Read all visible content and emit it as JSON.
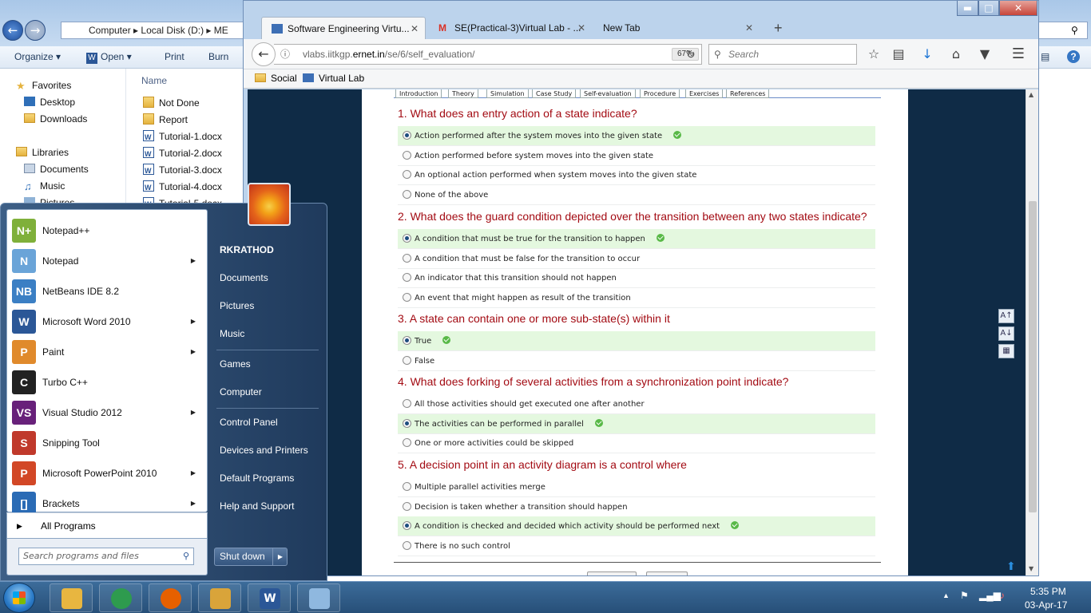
{
  "explorer": {
    "address": [
      "Computer",
      "Local Disk (D:)",
      "ME"
    ],
    "toolbar": {
      "organize": "Organize",
      "open": "Open",
      "print": "Print",
      "burn": "Burn"
    },
    "nav": {
      "favorites": "Favorites",
      "desktop": "Desktop",
      "downloads": "Downloads",
      "libraries": "Libraries",
      "documents": "Documents",
      "music": "Music",
      "pictures": "Pictures"
    },
    "column_name": "Name",
    "files": [
      "Not Done",
      "Report",
      "Tutorial-1.docx",
      "Tutorial-2.docx",
      "Tutorial-3.docx",
      "Tutorial-4.docx",
      "Tutorial-5.docx"
    ]
  },
  "firefox": {
    "tabs": [
      {
        "label": "Software Engineering Virtu..."
      },
      {
        "label": "SE(Practical-3)Virtual Lab - ..."
      },
      {
        "label": "New Tab"
      }
    ],
    "url_prefix": "vlabs.iitkgp.",
    "url_domain": "ernet.in",
    "url_path": "/se/6/self_evaluation/",
    "zoom": "67%",
    "search_placeholder": "Search",
    "bookmarks": [
      "Social",
      "Virtual Lab"
    ]
  },
  "lab": {
    "tabs": [
      "Introduction",
      "Theory",
      "Simulation",
      "Case Study",
      "Self-evaluation",
      "Procedure",
      "Exercises",
      "References"
    ],
    "questions": [
      {
        "text": "1. What does an entry action of a state indicate?",
        "options": [
          {
            "text": "Action performed after the system moves into the given state",
            "selected": true,
            "correct": true
          },
          {
            "text": "Action performed before system moves into the given state",
            "selected": false,
            "correct": false
          },
          {
            "text": "An optional action performed when system moves into the given state",
            "selected": false,
            "correct": false
          },
          {
            "text": "None of the above",
            "selected": false,
            "correct": false
          }
        ]
      },
      {
        "text": "2. What does the guard condition depicted over the transition between any two states indicate?",
        "options": [
          {
            "text": "A condition that must be true for the transition to happen",
            "selected": true,
            "correct": true
          },
          {
            "text": "A condition that must be false for the transition to occur",
            "selected": false,
            "correct": false
          },
          {
            "text": "An indicator that this transition should not happen",
            "selected": false,
            "correct": false
          },
          {
            "text": "An event that might happen as result of the transition",
            "selected": false,
            "correct": false
          }
        ]
      },
      {
        "text": "3. A state can contain one or more sub-state(s) within it",
        "options": [
          {
            "text": "True",
            "selected": true,
            "correct": true
          },
          {
            "text": "False",
            "selected": false,
            "correct": false
          }
        ]
      },
      {
        "text": "4. What does forking of several activities from a synchronization point indicate?",
        "options": [
          {
            "text": "All those activities should get executed one after another",
            "selected": false,
            "correct": false
          },
          {
            "text": "The activities can be performed in parallel",
            "selected": true,
            "correct": true
          },
          {
            "text": "One or more activities could be skipped",
            "selected": false,
            "correct": false
          }
        ]
      },
      {
        "text": "5. A decision point in an activity diagram is a control where",
        "options": [
          {
            "text": "Multiple parallel activities merge",
            "selected": false,
            "correct": false
          },
          {
            "text": "Decision is taken whether a transition should happen",
            "selected": false,
            "correct": false
          },
          {
            "text": "A condition is checked and decided which activity should be performed next",
            "selected": true,
            "correct": true
          },
          {
            "text": "There is no such control",
            "selected": false,
            "correct": false
          }
        ]
      }
    ]
  },
  "startmenu": {
    "programs": [
      {
        "label": "Notepad++",
        "icon": "notepadpp-icon",
        "color": "#7fb03a",
        "glyph": "N+",
        "arrow": false
      },
      {
        "label": "Notepad",
        "icon": "notepad-icon",
        "color": "#6aa4d8",
        "glyph": "N",
        "arrow": true
      },
      {
        "label": "NetBeans IDE 8.2",
        "icon": "netbeans-icon",
        "color": "#3b7fc4",
        "glyph": "NB",
        "arrow": false
      },
      {
        "label": "Microsoft Word 2010",
        "icon": "word-icon",
        "color": "#2b5797",
        "glyph": "W",
        "arrow": true
      },
      {
        "label": "Paint",
        "icon": "paint-icon",
        "color": "#e08a2c",
        "glyph": "P",
        "arrow": true
      },
      {
        "label": "Turbo C++",
        "icon": "turbo-cpp-icon",
        "color": "#222222",
        "glyph": "C",
        "arrow": false
      },
      {
        "label": "Visual Studio 2012",
        "icon": "visual-studio-icon",
        "color": "#68217a",
        "glyph": "VS",
        "arrow": true
      },
      {
        "label": "Snipping Tool",
        "icon": "snipping-tool-icon",
        "color": "#c0392b",
        "glyph": "S",
        "arrow": false
      },
      {
        "label": "Microsoft PowerPoint 2010",
        "icon": "powerpoint-icon",
        "color": "#d24726",
        "glyph": "P",
        "arrow": true
      },
      {
        "label": "Brackets",
        "icon": "brackets-icon",
        "color": "#2a6bb5",
        "glyph": "[]",
        "arrow": true
      }
    ],
    "all_programs": "All Programs",
    "search_placeholder": "Search programs and files",
    "user": "RKRATHOD",
    "right_items": [
      "Documents",
      "Pictures",
      "Music",
      "Games",
      "Computer",
      "Control Panel",
      "Devices and Printers",
      "Default Programs",
      "Help and Support"
    ],
    "shutdown": "Shut down"
  },
  "taskbar": {
    "apps": [
      {
        "name": "explorer-icon",
        "color": "#e8b640",
        "glyph": ""
      },
      {
        "name": "chrome-icon",
        "color": "#2e9b4e",
        "glyph": ""
      },
      {
        "name": "firefox-icon",
        "color": "#e66000",
        "glyph": ""
      },
      {
        "name": "file-manager-icon",
        "color": "#d9a43a",
        "glyph": ""
      },
      {
        "name": "word-icon",
        "color": "#2b5797",
        "glyph": "W"
      },
      {
        "name": "notepad-icon",
        "color": "#8fb8df",
        "glyph": ""
      }
    ],
    "time": "5:35 PM",
    "date": "03-Apr-17"
  }
}
